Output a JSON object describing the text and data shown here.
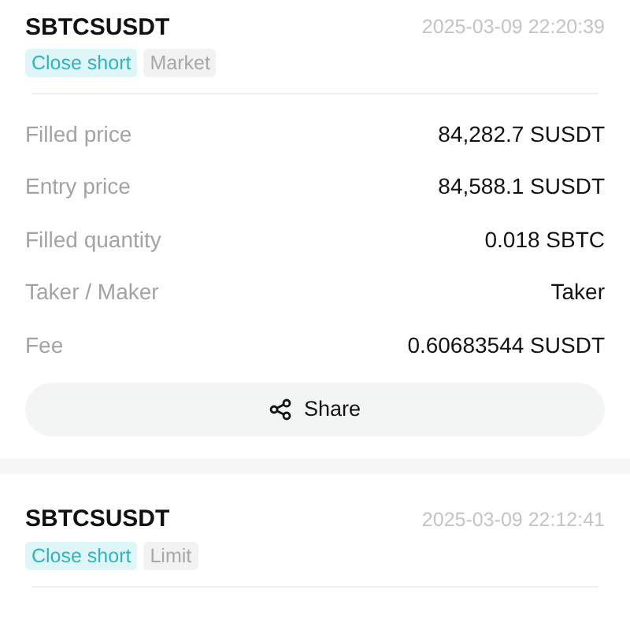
{
  "orders": [
    {
      "symbol": "SBTCSUSDT",
      "time": "2025-03-09 22:20:39",
      "tags": [
        {
          "label": "Close short",
          "kind": "side"
        },
        {
          "label": "Market",
          "kind": "type"
        }
      ],
      "rows": [
        {
          "label": "Filled price",
          "value": "84,282.7 SUSDT"
        },
        {
          "label": "Entry price",
          "value": "84,588.1 SUSDT"
        },
        {
          "label": "Filled quantity",
          "value": "0.018 SBTC"
        },
        {
          "label": "Taker / Maker",
          "value": "Taker"
        },
        {
          "label": "Fee",
          "value": "0.60683544 SUSDT"
        }
      ],
      "share": "Share"
    },
    {
      "symbol": "SBTCSUSDT",
      "time": "2025-03-09 22:12:41",
      "tags": [
        {
          "label": "Close short",
          "kind": "side"
        },
        {
          "label": "Limit",
          "kind": "type"
        }
      ]
    }
  ]
}
